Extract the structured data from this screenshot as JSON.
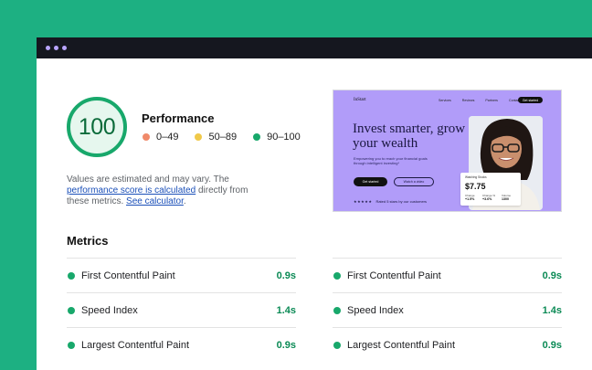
{
  "window": {
    "chrome_dots": [
      "dot",
      "dot",
      "dot"
    ]
  },
  "report": {
    "score": "100",
    "score_fraction": 1.0,
    "category_title": "Performance",
    "legend": [
      {
        "label": "0–49",
        "color": "#f08a6a"
      },
      {
        "label": "50–89",
        "color": "#f0c94a"
      },
      {
        "label": "90–100",
        "color": "#18a86b"
      }
    ],
    "note": {
      "text1": "Values are estimated and may vary. The ",
      "link1": "performance score is calculated",
      "text2": " directly from these metrics. ",
      "link2": "See calculator",
      "text3": "."
    }
  },
  "preview": {
    "brand": "InStart",
    "nav": [
      "Services",
      "Reviews",
      "Partners",
      "Contacts"
    ],
    "nav_button": "Get started",
    "headline": "Invest smarter, grow your wealth",
    "subtext": "Empowering you to reach your financial goals through intelligent investing*",
    "primary_button": "Get started",
    "secondary_button": "Watch a video",
    "rating_text": "Rated 5 stars by our customers",
    "stock_card": {
      "title": "Watching Stocks",
      "price": "$7.75",
      "stats": [
        {
          "label": "Change",
          "value": "+1.5%"
        },
        {
          "label": "Change %",
          "value": "+3.6%"
        },
        {
          "label": "Volume",
          "value": "1300"
        }
      ]
    }
  },
  "metrics": {
    "title": "Metrics",
    "status_color": "#18a86b",
    "items": [
      {
        "name": "First Contentful Paint",
        "value": "0.9s"
      },
      {
        "name": "First Contentful Paint",
        "value": "0.9s"
      },
      {
        "name": "Speed Index",
        "value": "1.4s"
      },
      {
        "name": "Speed Index",
        "value": "1.4s"
      },
      {
        "name": "Largest Contentful Paint",
        "value": "0.9s"
      },
      {
        "name": "Largest Contentful Paint",
        "value": "0.9s"
      }
    ]
  }
}
